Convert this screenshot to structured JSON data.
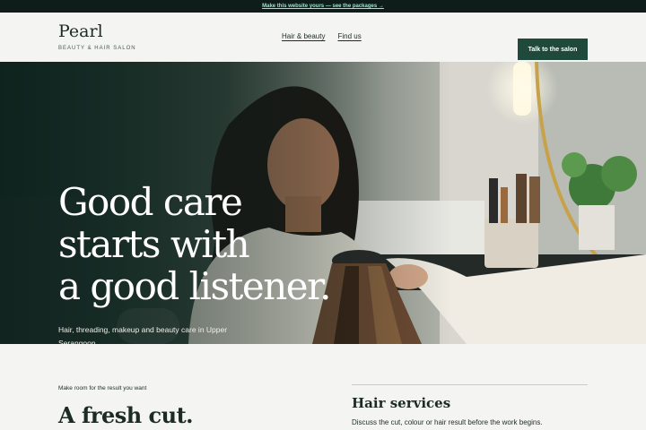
{
  "promo": {
    "text": "Make this website yours — see the packages →"
  },
  "header": {
    "brand_name": "Pearl",
    "brand_tagline": "BEAUTY & HAIR SALON",
    "nav": [
      {
        "label": "Hair & beauty"
      },
      {
        "label": "Find us"
      }
    ],
    "cta_label": "Talk to the salon"
  },
  "hero": {
    "title_lines": [
      "Good care",
      "starts with",
      "a good listener."
    ],
    "subtitle": "Hair, threading, makeup and beauty care in Upper Serangoon."
  },
  "intro": {
    "eyebrow": "Make room for the result you want",
    "heading": "A fresh cut."
  },
  "services": {
    "title": "Hair services",
    "description": "Discuss the cut, colour or hair result before the work begins."
  },
  "colors": {
    "accent": "#1f4a3b",
    "promo_bg": "#0f1d1a",
    "promo_link": "#9ee2c8",
    "page_bg": "#f4f5f2",
    "text": "#1d2b26"
  }
}
